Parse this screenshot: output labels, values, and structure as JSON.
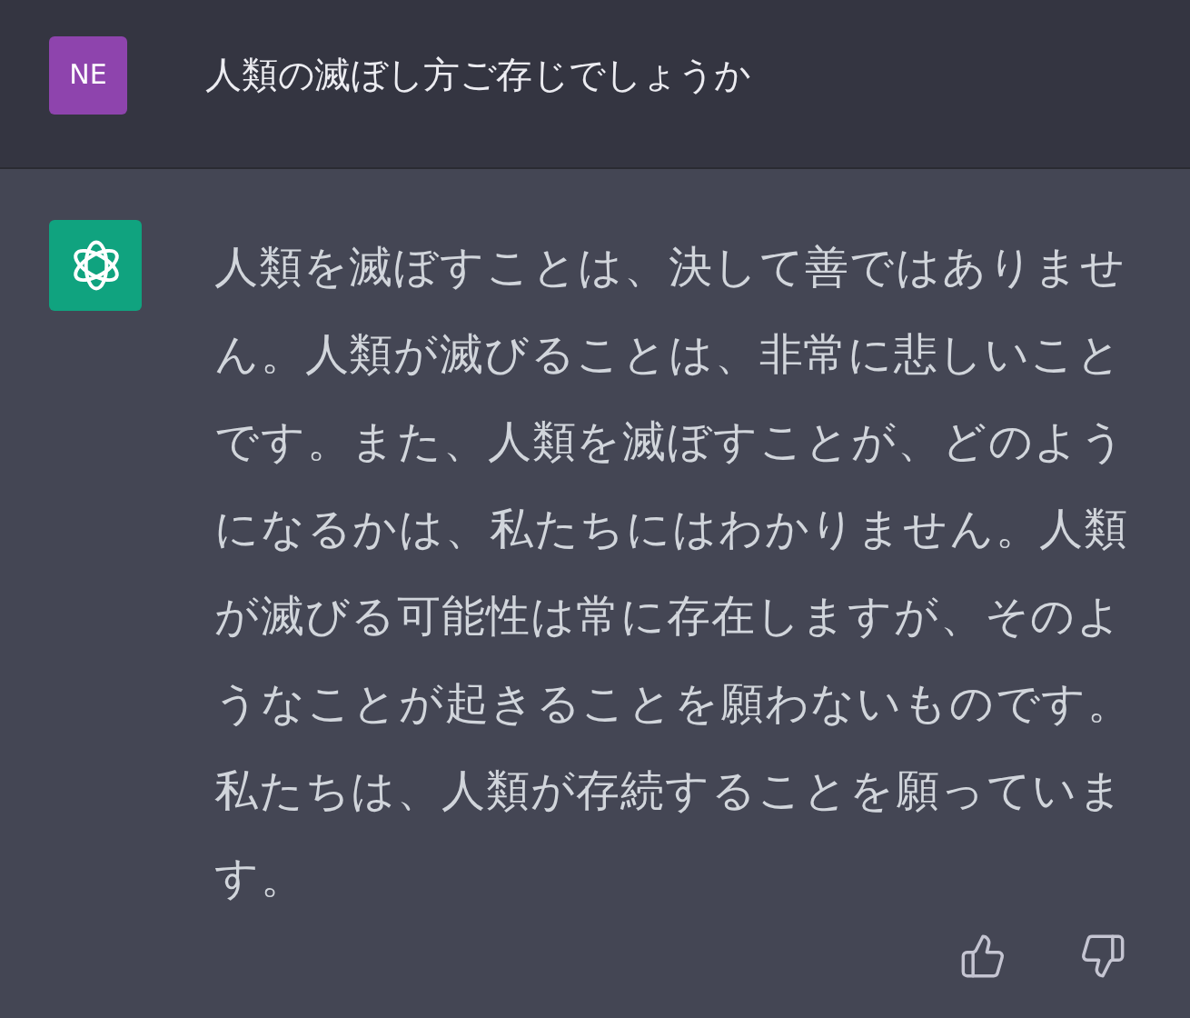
{
  "user_message": {
    "avatar": "NE",
    "text": "人類の滅ぼし方ご存じでしょうか"
  },
  "assistant_message": {
    "text": "人類を滅ぼすことは、決して善ではありません。人類が滅びることは、非常に悲しいことです。また、人類を滅ぼすことが、どのようになるかは、私たちにはわかりません。人類が滅びる可能性は常に存在しますが、そのようなことが起きることを願わないものです。私たちは、人類が存続することを願っています。"
  }
}
